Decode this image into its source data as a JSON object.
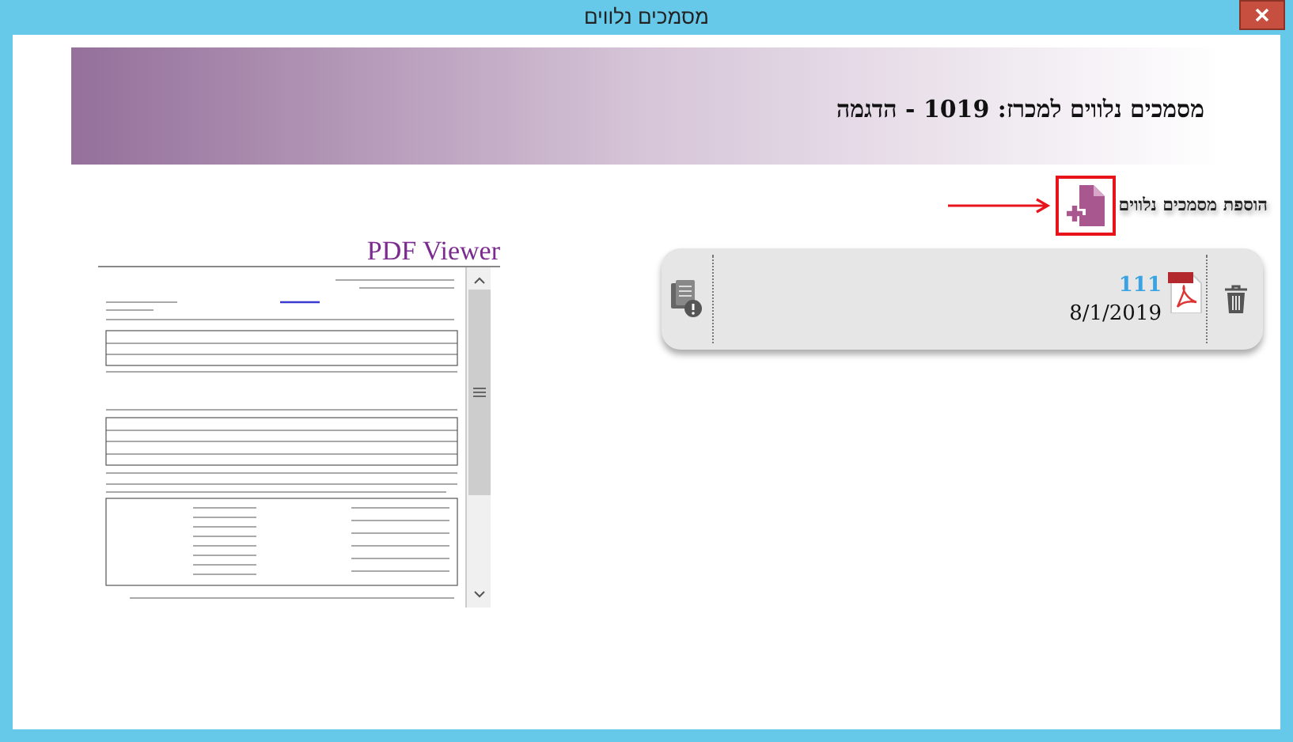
{
  "window": {
    "title": "מסמכים נלווים"
  },
  "header": {
    "title": "מסמכים נלווים למכרז: 1019 - הדגמה"
  },
  "add_documents": {
    "label": "הוספת מסמכים נלווים"
  },
  "documents": [
    {
      "name": "111",
      "date": "8/1/2019"
    }
  ],
  "viewer": {
    "title": "PDF Viewer"
  }
}
